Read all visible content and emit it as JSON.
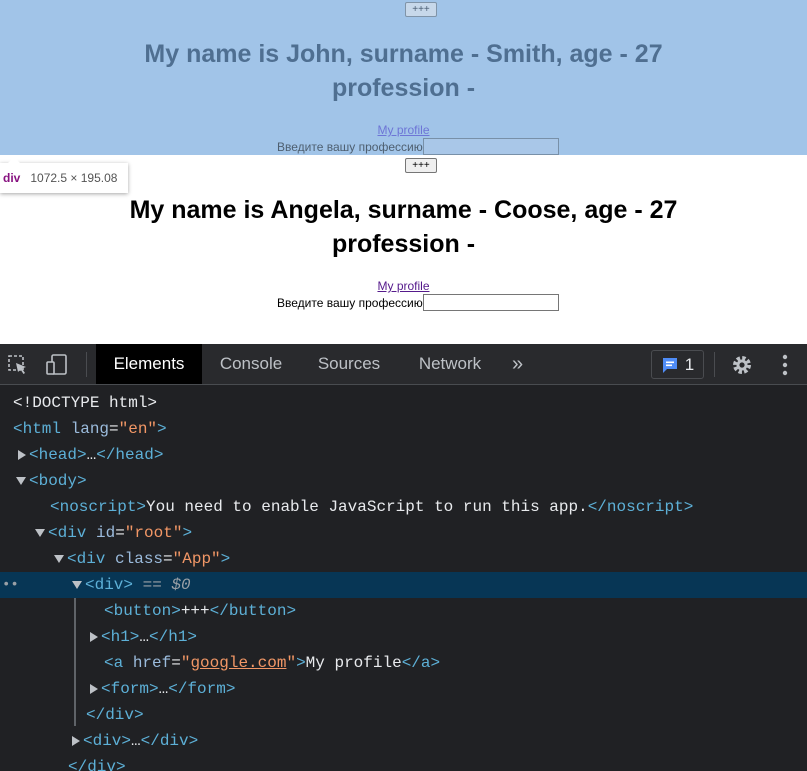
{
  "page": {
    "cards": [
      {
        "button_label": "+++",
        "heading_line1": "My name is John, surname - Smith, age - 27",
        "heading_line2": "profession -",
        "link_text": "My profile",
        "form_label": "Введите вашу профессию",
        "input_value": ""
      },
      {
        "button_label": "+++",
        "heading_line1": "My name is Angela, surname - Coose, age - 27",
        "heading_line2": "profession -",
        "link_text": "My profile",
        "form_label": "Введите вашу профессию",
        "input_value": ""
      }
    ],
    "tooltip": {
      "tag": "div",
      "size": "1072.5 × 195.08"
    },
    "colors": {
      "highlight": "#a1c4e8"
    }
  },
  "devtools": {
    "tabs": [
      {
        "label": "Elements",
        "active": true
      },
      {
        "label": "Console",
        "active": false
      },
      {
        "label": "Sources",
        "active": false
      },
      {
        "label": "Network",
        "active": false
      }
    ],
    "more_tabs": "»",
    "issues_count": "1",
    "tree": {
      "doctype": "<!DOCTYPE html>",
      "html_open": "<html ",
      "html_attr": "lang",
      "html_val": "\"en\"",
      "html_close": ">",
      "head_open": "<head>",
      "head_ellipsis": "…",
      "head_close": "</head>",
      "body_open": "<body>",
      "noscript_open": "<noscript>",
      "noscript_text": "You need to enable JavaScript to run this app.",
      "noscript_close": "</noscript>",
      "div_root_open": "<div ",
      "div_root_attr": "id",
      "div_root_val": "\"root\"",
      "div_app_attr": "class",
      "div_app_val": "\"App\"",
      "div_sel_open": "<div>",
      "dollar_eq": " == ",
      "dollar": "$0",
      "button_open": "<button>",
      "button_text": "+++",
      "button_close": "</button>",
      "h1_open": "<h1>",
      "ellipsis": "…",
      "h1_close": "</h1>",
      "a_open": "<a ",
      "a_attr": "href",
      "a_val": "google.com",
      "a_text": "My profile",
      "a_close": "</a>",
      "form_open": "<form>",
      "form_close": "</form>",
      "div_close": "</div>",
      "div_open": "<div>",
      "close_angle": ">",
      "eq": "=",
      "quote": "\""
    }
  }
}
